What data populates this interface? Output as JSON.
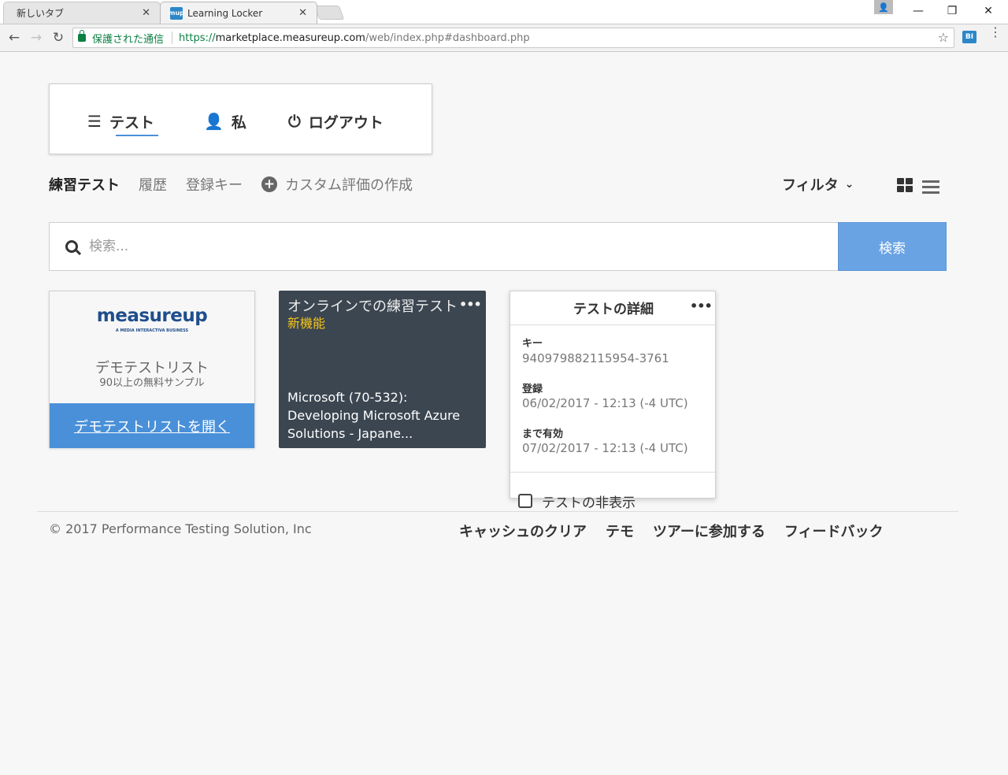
{
  "browser": {
    "tabs": [
      {
        "title": "新しいタブ",
        "close": "✕"
      },
      {
        "title": "Learning Locker",
        "favicon": "mup",
        "close": "✕"
      }
    ],
    "window_controls": {
      "minimize": "—",
      "restore": "❐",
      "close": "✕"
    },
    "profile_icon": "👤",
    "nav": {
      "back": "←",
      "forward": "→",
      "reload": "↻"
    },
    "secure_label": "保護された通信",
    "url": {
      "scheme": "https://",
      "host": "marketplace.measureup.com",
      "path": "/web/index.php#dashboard.php"
    },
    "star": "☆",
    "extension_icon": "BI",
    "menu": "⋮"
  },
  "top_nav": {
    "items": [
      {
        "label": "テスト",
        "icon": "list-icon",
        "glyph": "☰"
      },
      {
        "label": "私",
        "icon": "user-icon",
        "glyph": "👤"
      },
      {
        "label": "ログアウト",
        "icon": "power-icon",
        "glyph": "⏻"
      }
    ]
  },
  "subnav": {
    "items": [
      "練習テスト",
      "履歴",
      "登録キー"
    ],
    "create_label": "カスタム評価の作成",
    "create_glyph": "+",
    "filter_label": "フィルタ",
    "filter_chevron": "⌄"
  },
  "search": {
    "placeholder": "検索...",
    "button": "検索"
  },
  "demo_card": {
    "logo": "measureup",
    "logo_tagline": "A MEDIA INTERACTIVA BUSINESS",
    "title": "デモテストリスト",
    "subtitle": "90以上の無料サンプル",
    "button": "デモテストリストを開く"
  },
  "exam_card": {
    "title": "オンラインでの練習テスト",
    "badge": "新機能",
    "dots": "•••",
    "name": "Microsoft (70-532): Developing Microsoft Azure Solutions - Japane..."
  },
  "detail_card": {
    "title": "テストの詳細",
    "dots": "•••",
    "fields": [
      {
        "label": "キー",
        "value": "940979882115954-3761"
      },
      {
        "label": "登録",
        "value": "06/02/2017 - 12:13 (-4 UTC)"
      },
      {
        "label": "まで有効",
        "value": "07/02/2017 - 12:13 (-4 UTC)"
      }
    ],
    "hide_label": "テストの非表示"
  },
  "footer": {
    "copyright": "© 2017 Performance Testing Solution, Inc",
    "links": [
      "キャッシュのクリア",
      "テモ",
      "ツアーに参加する",
      "フィードバック"
    ]
  },
  "colors": {
    "accent": "#4a90d9",
    "search_button": "#6aa3e4",
    "exam_card_bg": "#3b4651",
    "badge": "#f5c518",
    "secure": "#0b8043"
  }
}
